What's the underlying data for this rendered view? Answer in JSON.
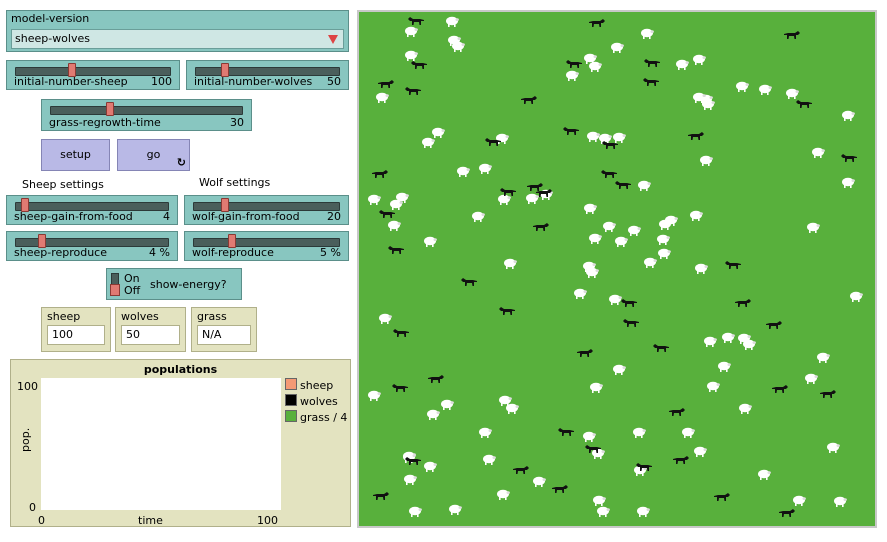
{
  "chooser": {
    "label": "model-version",
    "value": "sheep-wolves"
  },
  "sliders": {
    "initial_sheep": {
      "name": "initial-number-sheep",
      "value": "100",
      "fraction": 0.36
    },
    "initial_wolves": {
      "name": "initial-number-wolves",
      "value": "50",
      "fraction": 0.19
    },
    "grass_regrowth": {
      "name": "grass-regrowth-time",
      "value": "30",
      "fraction": 0.3
    },
    "sheep_gain": {
      "name": "sheep-gain-from-food",
      "value": "4",
      "fraction": 0.04
    },
    "wolf_gain": {
      "name": "wolf-gain-from-food",
      "value": "20",
      "fraction": 0.2
    },
    "sheep_reproduce": {
      "name": "sheep-reproduce",
      "value": "4 %",
      "fraction": 0.16
    },
    "wolf_reproduce": {
      "name": "wolf-reproduce",
      "value": "5 %",
      "fraction": 0.25
    }
  },
  "buttons": {
    "setup": "setup",
    "go": "go"
  },
  "sections": {
    "sheep": "Sheep settings",
    "wolf": "Wolf settings"
  },
  "switch": {
    "on": "On",
    "off": "Off",
    "label": "show-energy?"
  },
  "monitors": {
    "sheep": {
      "label": "sheep",
      "value": "100"
    },
    "wolves": {
      "label": "wolves",
      "value": "50"
    },
    "grass": {
      "label": "grass",
      "value": "N/A"
    }
  },
  "plot": {
    "title": "populations",
    "ymax": "100",
    "ymin": "0",
    "xmin": "0",
    "xmax": "100",
    "xlabel": "time",
    "ylabel": "pop.",
    "legend": [
      {
        "label": "sheep",
        "color": "#f49a75"
      },
      {
        "label": "wolves",
        "color": "#000000"
      },
      {
        "label": "grass / 4",
        "color": "#58b03c"
      }
    ]
  },
  "colors": {
    "world": "#58b03c",
    "widget": "#88c6c0",
    "button": "#b9b9e6",
    "monitor": "#e3e3c0"
  }
}
